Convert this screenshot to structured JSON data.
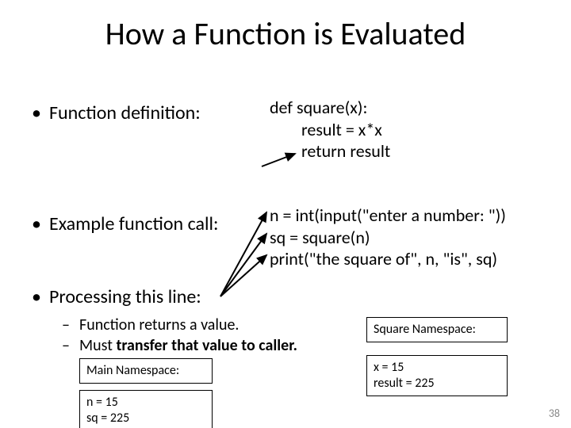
{
  "title": "How a Function is Evaluated",
  "bullets": {
    "definition": "Function definition:",
    "example": "Example function call:",
    "processing": "Processing this line:"
  },
  "code": {
    "def_line": "def square(x):",
    "def_body1": "result = x*x",
    "def_body2": "return result",
    "call_line1": "n = int(input(\"enter a number: \"))",
    "call_line2": "sq = square(n)",
    "call_line3": "print(\"the square of\", n, \"is\", sq)"
  },
  "subs": {
    "s1": "Function returns a value.",
    "s2_prefix": "Must ",
    "s2_bold": "transfer that value to caller."
  },
  "namespaces": {
    "main_label": "Main Namespace:",
    "main_vals_l1": "n = 15",
    "main_vals_l2": "sq = 225",
    "sq_label": "Square Namespace:",
    "sq_vals_l1": "x = 15",
    "sq_vals_l2": "result = 225"
  },
  "page_number": "38"
}
